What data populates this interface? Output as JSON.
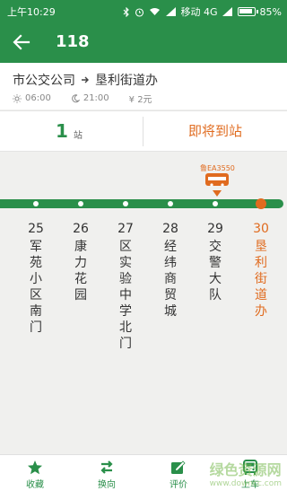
{
  "status": {
    "time": "上午10:29",
    "carrier": "移动 4G",
    "battery": "85%"
  },
  "header": {
    "title": "118"
  },
  "route": {
    "from": "市公交公司",
    "to": "垦利街道办",
    "first": "06:00",
    "last": "21:00",
    "fare": "¥ 2元"
  },
  "info": {
    "stops_count": "1",
    "stops_unit": "站",
    "arrival": "即将到站"
  },
  "bus": {
    "plate": "鲁EA3550"
  },
  "stops": [
    {
      "num": "25",
      "name": [
        "军",
        "苑",
        "小",
        "区",
        "南",
        "门"
      ]
    },
    {
      "num": "26",
      "name": [
        "康",
        "力",
        "花",
        "园"
      ]
    },
    {
      "num": "27",
      "name": [
        "区",
        "实",
        "验",
        "中",
        "学",
        "北",
        "门"
      ]
    },
    {
      "num": "28",
      "name": [
        "经",
        "纬",
        "商",
        "贸",
        "城"
      ]
    },
    {
      "num": "29",
      "name": [
        "交",
        "警",
        "大",
        "队"
      ]
    },
    {
      "num": "30",
      "name": [
        "垦",
        "利",
        "街",
        "道",
        "办"
      ]
    }
  ],
  "tabs": [
    {
      "label": "收藏",
      "icon": "star-icon"
    },
    {
      "label": "换向",
      "icon": "swap-icon"
    },
    {
      "label": "评价",
      "icon": "edit-icon"
    },
    {
      "label": "上车",
      "icon": "bus-icon"
    }
  ],
  "watermark": {
    "main": "绿色资源网",
    "sub": "www.downcc.com"
  },
  "colors": {
    "primary": "#2a8f4a",
    "accent": "#e06b1f"
  }
}
